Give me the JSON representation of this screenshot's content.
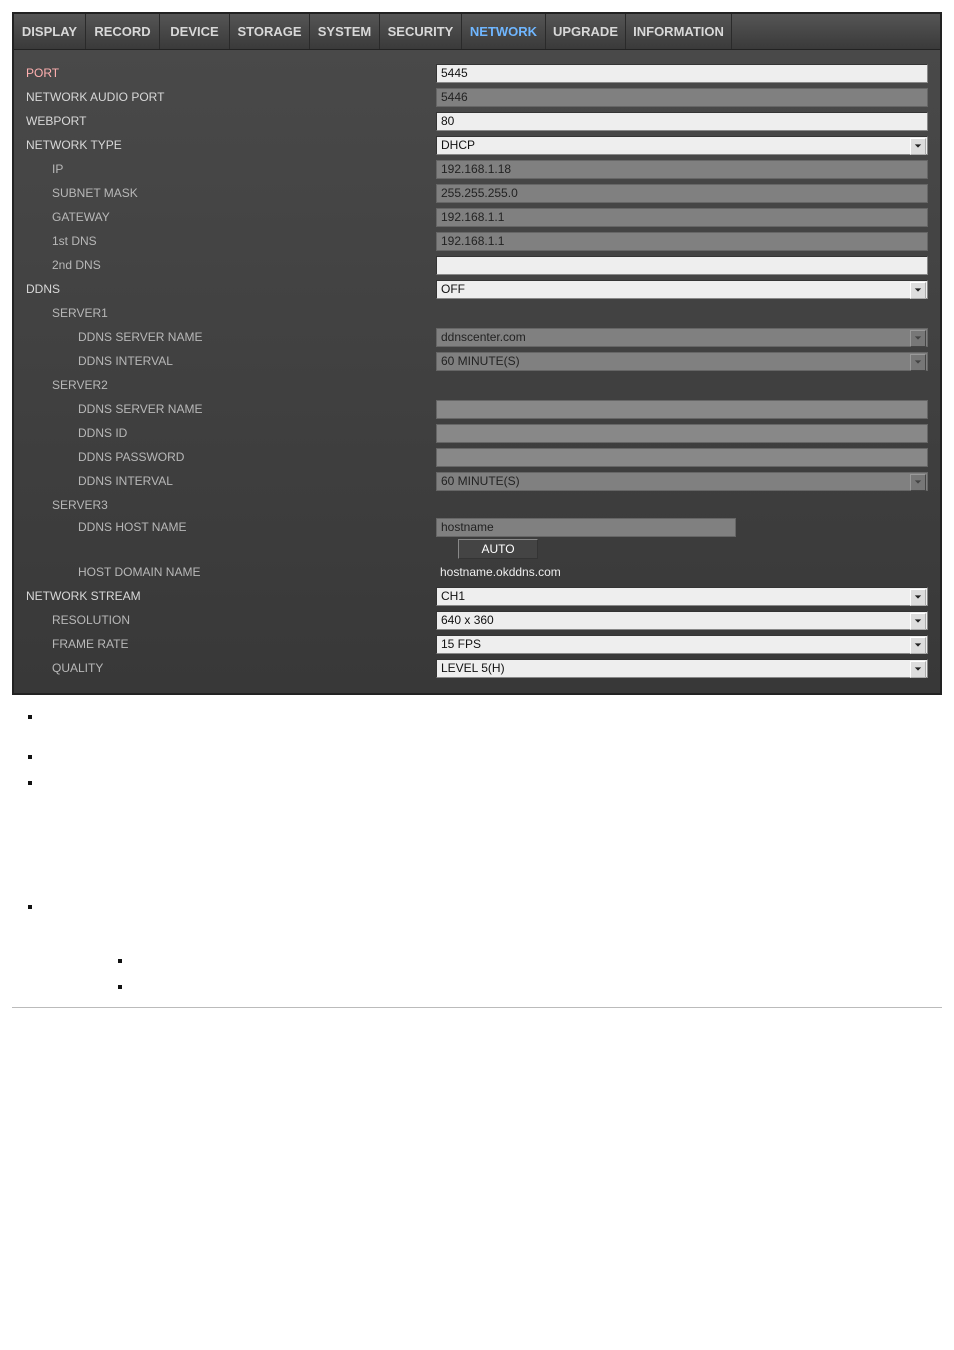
{
  "tabs": {
    "display": "DISPLAY",
    "record": "RECORD",
    "device": "DEVICE",
    "storage": "STORAGE",
    "system": "SYSTEM",
    "security": "SECURITY",
    "network": "NETWORK",
    "upgrade": "UPGRADE",
    "information": "INFORMATION"
  },
  "labels": {
    "port": "PORT",
    "network_audio_port": "NETWORK AUDIO PORT",
    "webport": "WEBPORT",
    "network_type": "NETWORK TYPE",
    "ip": "IP",
    "subnet_mask": "SUBNET MASK",
    "gateway": "GATEWAY",
    "dns1": "1st DNS",
    "dns2": "2nd DNS",
    "ddns": "DDNS",
    "server1": "SERVER1",
    "server2": "SERVER2",
    "server3": "SERVER3",
    "ddns_server_name": "DDNS SERVER NAME",
    "ddns_interval": "DDNS INTERVAL",
    "ddns_id": "DDNS ID",
    "ddns_password": "DDNS PASSWORD",
    "ddns_host_name": "DDNS HOST NAME",
    "host_domain_name": "HOST DOMAIN NAME",
    "network_stream": "NETWORK STREAM",
    "resolution": "RESOLUTION",
    "frame_rate": "FRAME RATE",
    "quality": "QUALITY"
  },
  "values": {
    "port": "5445",
    "network_audio_port": "5446",
    "webport": "80",
    "network_type": "DHCP",
    "ip": "192.168.1.18",
    "subnet_mask": "255.255.255.0",
    "gateway": "192.168.1.1",
    "dns1": "192.168.1.1",
    "dns2": "",
    "ddns": "OFF",
    "s1_server_name": "ddnscenter.com",
    "s1_interval": "60 MINUTE(S)",
    "s2_server_name": "",
    "s2_id": "",
    "s2_password": "",
    "s2_interval": "60 MINUTE(S)",
    "s3_hostname": "hostname",
    "s3_auto": "AUTO",
    "s3_domain": "hostname.okddns.com",
    "network_stream": "CH1",
    "resolution": "640 x 360",
    "frame_rate": "15 FPS",
    "quality": "LEVEL 5(H)"
  }
}
